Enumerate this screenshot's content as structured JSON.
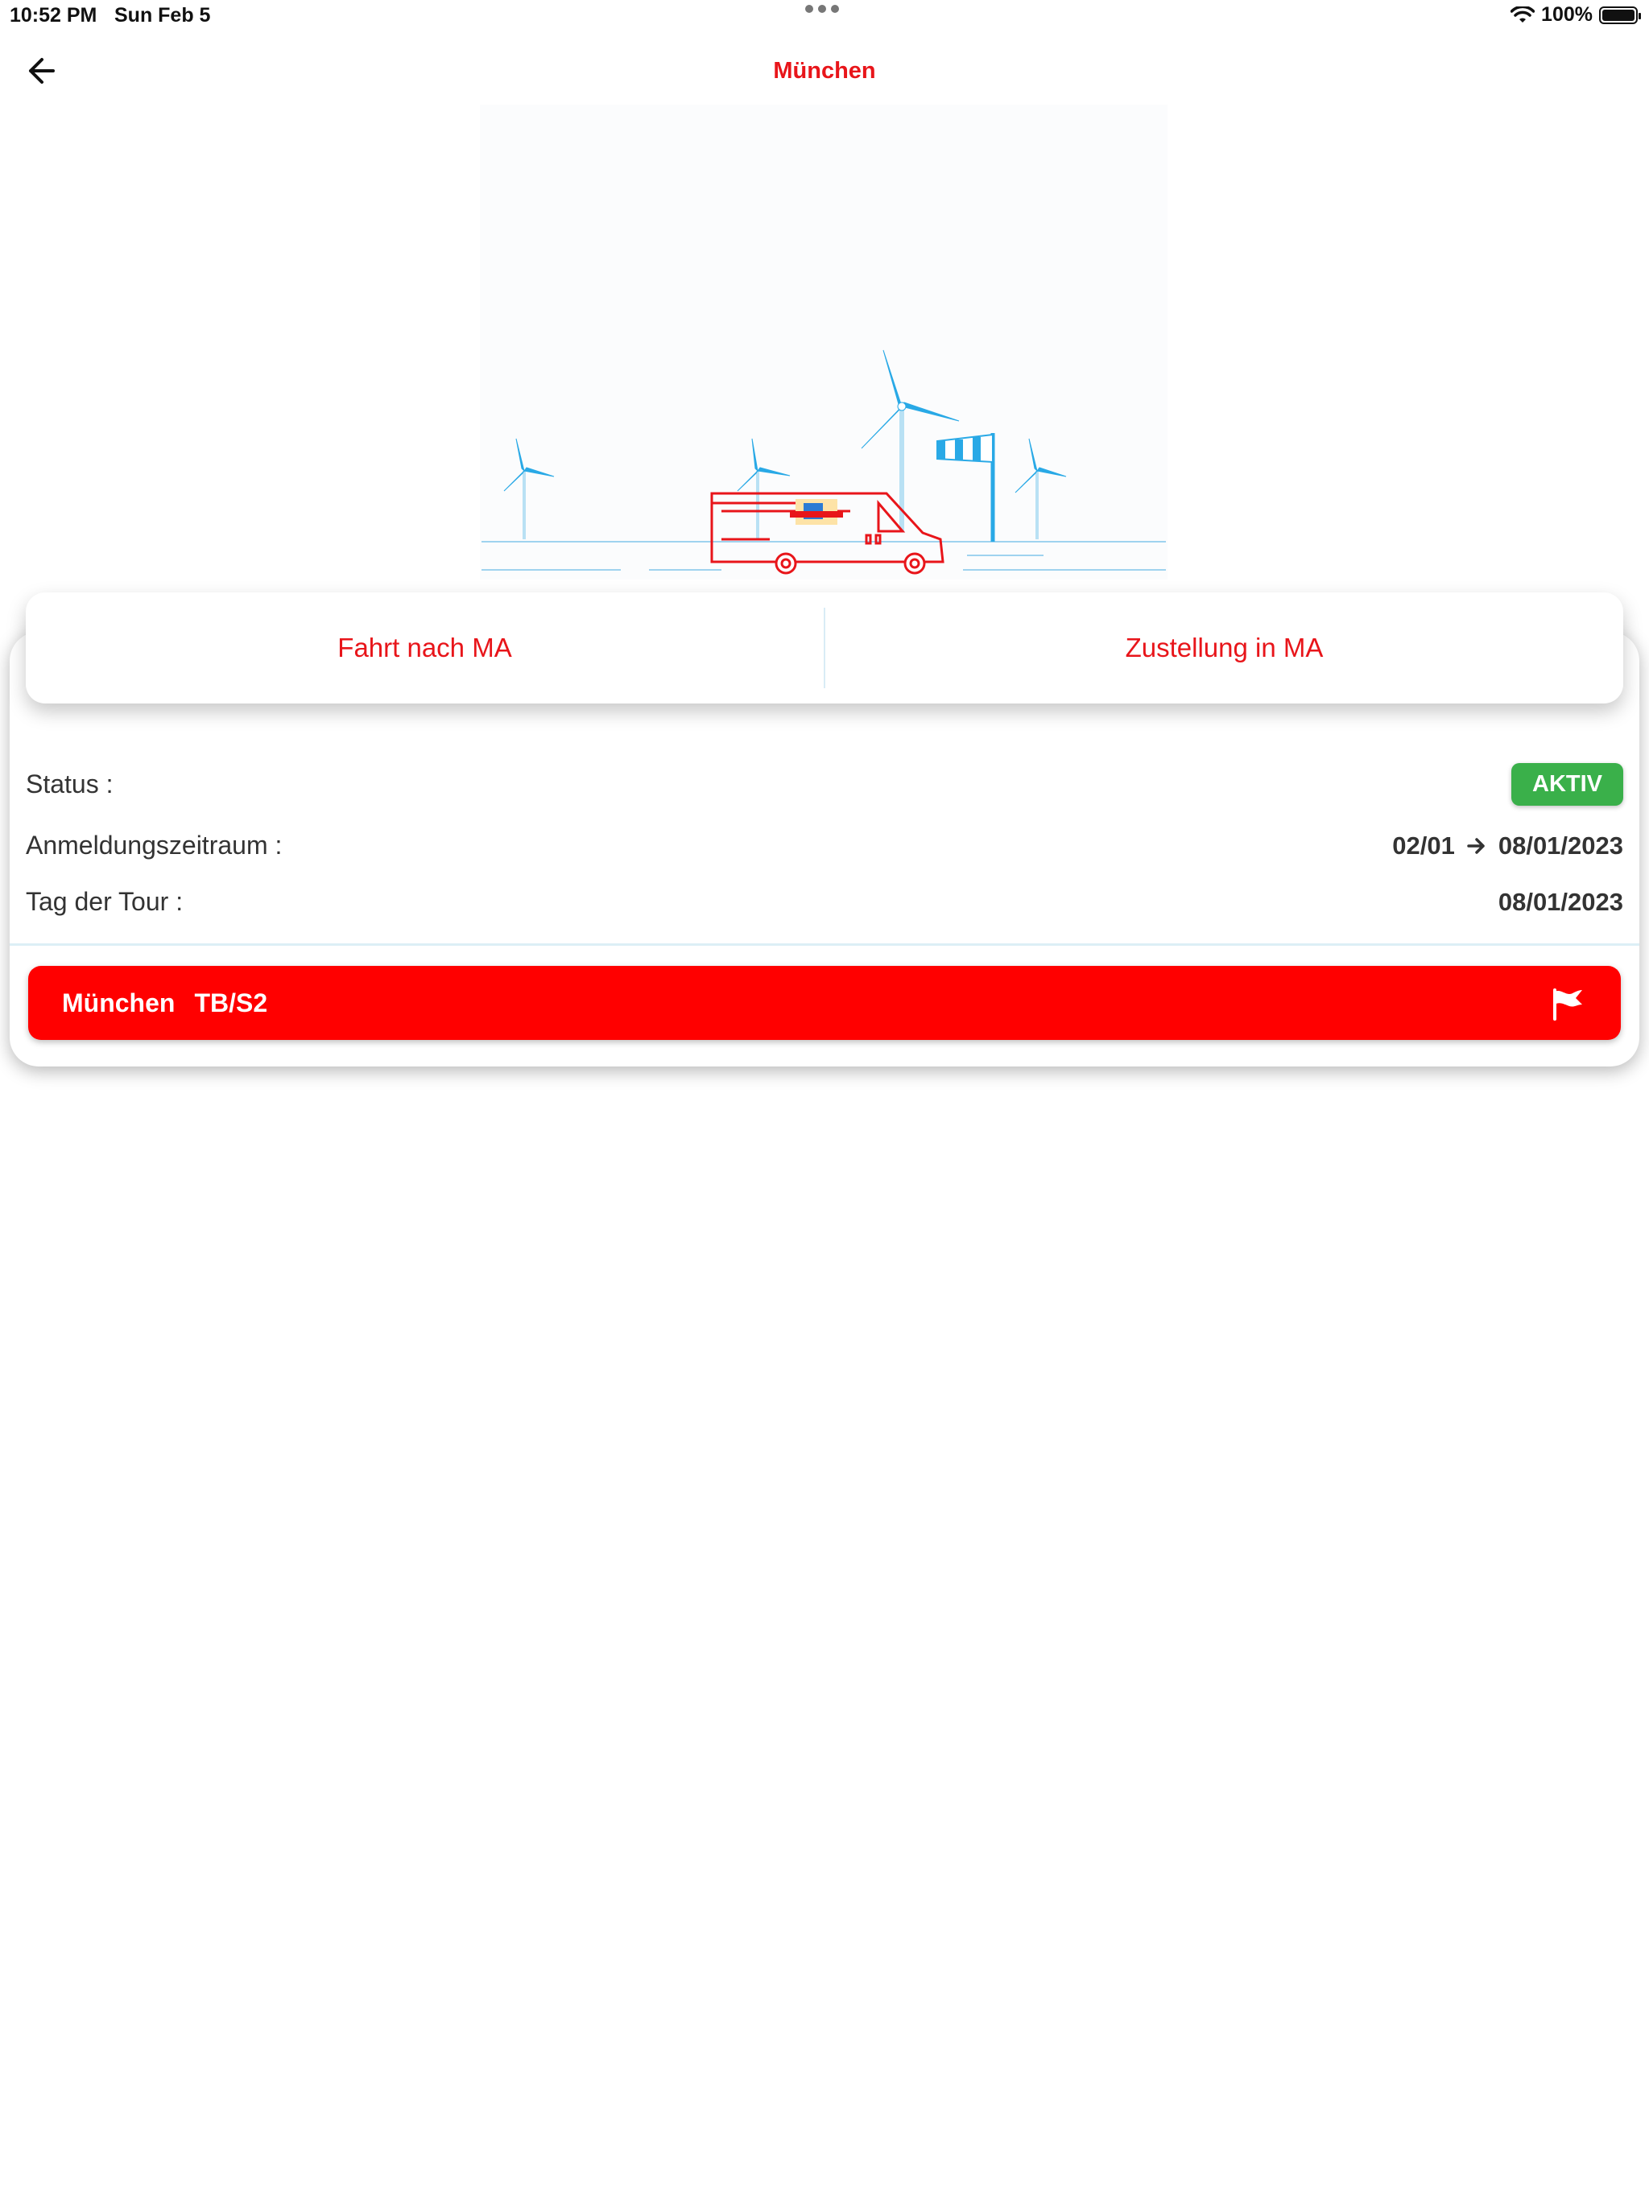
{
  "status_bar": {
    "time": "10:52 PM",
    "date": "Sun Feb 5",
    "battery": "100%"
  },
  "header": {
    "title": "München"
  },
  "tabs": [
    {
      "label": "Fahrt nach MA"
    },
    {
      "label": "Zustellung in MA"
    }
  ],
  "details": {
    "status_label": "Status :",
    "status_value": "AKTIV",
    "period_label": "Anmeldungszeitraum :",
    "period_start": "02/01",
    "period_end": "08/01/2023",
    "tour_day_label": "Tag der Tour :",
    "tour_day_value": "08/01/2023"
  },
  "route": {
    "city": "München",
    "code": "TB/S2"
  },
  "colors": {
    "accent": "#e8151a",
    "route_bar": "#ff0000",
    "status_active": "#3ab04a",
    "illustration_blue": "#29a9e6"
  }
}
